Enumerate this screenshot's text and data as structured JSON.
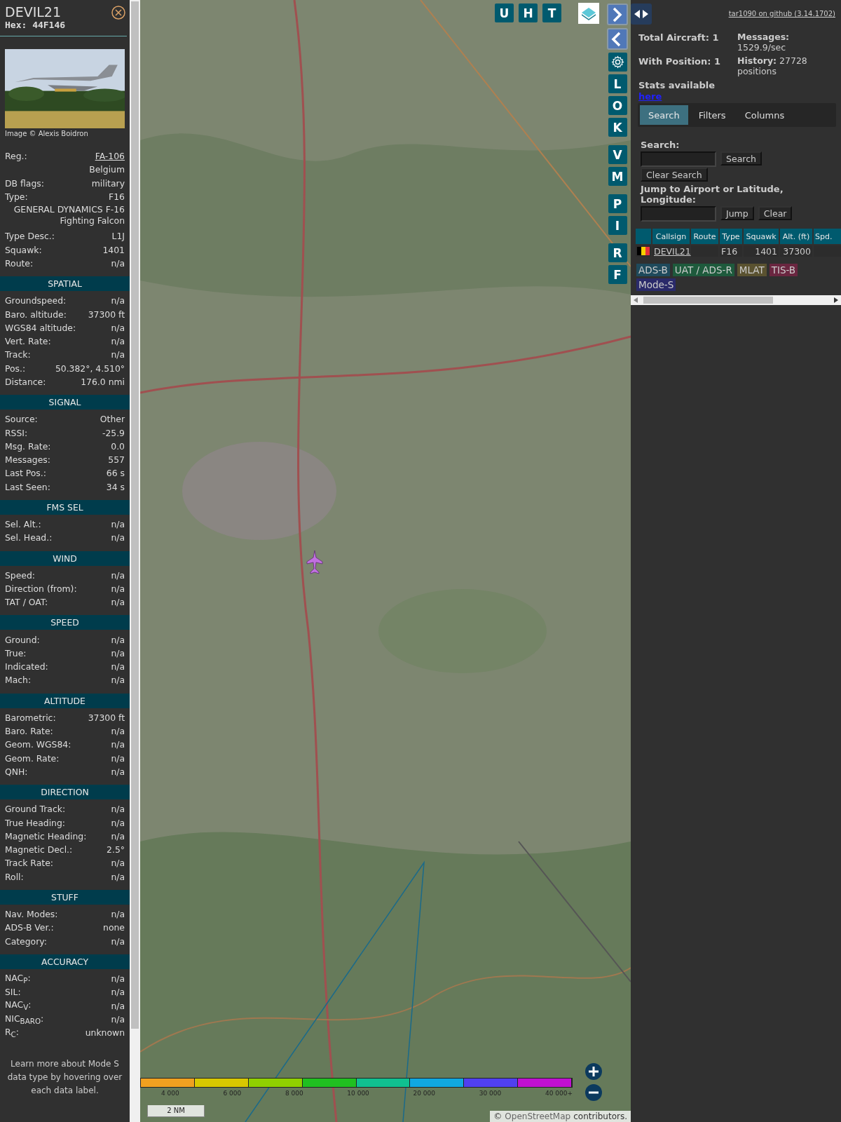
{
  "sidebar": {
    "callsign": "DEVIL21",
    "hex": "Hex: 44F146",
    "photo_credit": "Image © Alexis Boidron",
    "sections": [
      {
        "rows": [
          {
            "kind": "link",
            "label": "Reg.:",
            "value": "FA-106"
          },
          {
            "kind": "value",
            "value": "Belgium"
          },
          {
            "kind": "pair",
            "label": "DB flags:",
            "value": "military"
          },
          {
            "kind": "pair",
            "label": "Type:",
            "value": "F16"
          },
          {
            "kind": "wide",
            "value": "GENERAL DYNAMICS F-16 Fighting Falcon"
          },
          {
            "kind": "pair",
            "label": "Type Desc.:",
            "value": "L1J"
          },
          {
            "kind": "pair",
            "label": "Squawk:",
            "value": "1401"
          },
          {
            "kind": "pair",
            "label": "Route:",
            "value": "n/a"
          }
        ]
      },
      {
        "heading": "SPATIAL",
        "rows": [
          {
            "kind": "pair",
            "label": "Groundspeed:",
            "value": "n/a"
          },
          {
            "kind": "pair",
            "label": "Baro. altitude:",
            "value": "37300 ft"
          },
          {
            "kind": "pair",
            "label": "WGS84 altitude:",
            "value": "n/a"
          },
          {
            "kind": "pair",
            "label": "Vert. Rate:",
            "value": "n/a"
          },
          {
            "kind": "pair",
            "label": "Track:",
            "value": "n/a"
          },
          {
            "kind": "pair",
            "label": "Pos.:",
            "value": "50.382°, 4.510°"
          },
          {
            "kind": "pair",
            "label": "Distance:",
            "value": "176.0 nmi"
          }
        ]
      },
      {
        "heading": "SIGNAL",
        "rows": [
          {
            "kind": "pair",
            "label": "Source:",
            "value": "Other"
          },
          {
            "kind": "pair",
            "label": "RSSI:",
            "value": "-25.9"
          },
          {
            "kind": "pair",
            "label": "Msg. Rate:",
            "value": "0.0"
          },
          {
            "kind": "pair",
            "label": "Messages:",
            "value": "557"
          },
          {
            "kind": "pair",
            "label": "Last Pos.:",
            "value": "66 s"
          },
          {
            "kind": "pair",
            "label": "Last Seen:",
            "value": "34 s"
          }
        ]
      },
      {
        "heading": "FMS SEL",
        "rows": [
          {
            "kind": "pair",
            "label": "Sel. Alt.:",
            "value": "n/a"
          },
          {
            "kind": "pair",
            "label": "Sel. Head.:",
            "value": "n/a"
          }
        ]
      },
      {
        "heading": "WIND",
        "rows": [
          {
            "kind": "pair",
            "label": "Speed:",
            "value": "n/a"
          },
          {
            "kind": "pair",
            "label": "Direction (from):",
            "value": "n/a"
          },
          {
            "kind": "pair",
            "label": "TAT / OAT:",
            "value": "n/a"
          }
        ]
      },
      {
        "heading": "SPEED",
        "rows": [
          {
            "kind": "pair",
            "label": "Ground:",
            "value": "n/a"
          },
          {
            "kind": "pair",
            "label": "True:",
            "value": "n/a"
          },
          {
            "kind": "pair",
            "label": "Indicated:",
            "value": "n/a"
          },
          {
            "kind": "pair",
            "label": "Mach:",
            "value": "n/a"
          }
        ]
      },
      {
        "heading": "ALTITUDE",
        "rows": [
          {
            "kind": "pair",
            "label": "Barometric:",
            "value": "37300 ft"
          },
          {
            "kind": "pair",
            "label": "Baro. Rate:",
            "value": "n/a"
          },
          {
            "kind": "pair",
            "label": "Geom. WGS84:",
            "value": "n/a"
          },
          {
            "kind": "pair",
            "label": "Geom. Rate:",
            "value": "n/a"
          },
          {
            "kind": "pair",
            "label": "QNH:",
            "value": "n/a"
          }
        ]
      },
      {
        "heading": "DIRECTION",
        "rows": [
          {
            "kind": "pair",
            "label": "Ground Track:",
            "value": "n/a"
          },
          {
            "kind": "pair",
            "label": "True Heading:",
            "value": "n/a"
          },
          {
            "kind": "pair",
            "label": "Magnetic Heading:",
            "value": "n/a"
          },
          {
            "kind": "pair",
            "label": "Magnetic Decl.:",
            "value": "2.5°"
          },
          {
            "kind": "pair",
            "label": "Track Rate:",
            "value": "n/a"
          },
          {
            "kind": "pair",
            "label": "Roll:",
            "value": "n/a"
          }
        ]
      },
      {
        "heading": "STUFF",
        "rows": [
          {
            "kind": "pair",
            "label": "Nav. Modes:",
            "value": "n/a"
          },
          {
            "kind": "pair",
            "label": "ADS-B Ver.:",
            "value": "none"
          },
          {
            "kind": "pair",
            "label": "Category:",
            "value": "n/a"
          }
        ]
      },
      {
        "heading": "ACCURACY",
        "rows": [
          {
            "kind": "pair",
            "label": "NAC$_{P}$:",
            "value": "n/a"
          },
          {
            "kind": "pair",
            "label": "SIL:",
            "value": "n/a"
          },
          {
            "kind": "pair",
            "label": "NAC$_{V}$:",
            "value": "n/a"
          },
          {
            "kind": "pair",
            "label": "NIC$_{BARO}$:",
            "value": "n/a"
          },
          {
            "kind": "pair",
            "label": "R$_{C}$:",
            "value": "unknown"
          }
        ]
      }
    ],
    "note": "Learn more about Mode S data type by hovering over each data label."
  },
  "map": {
    "top_buttons": [
      "U",
      "H",
      "T"
    ],
    "side_buttons": [
      "L",
      "O",
      "K",
      "V",
      "M",
      "P",
      "I",
      "R",
      "F"
    ],
    "altitude_legend": [
      "4 000",
      "6 000",
      "8 000",
      "10 000",
      "20 000",
      "30 000",
      "40 000+"
    ],
    "scale": "2 NM",
    "attribution_prefix": "©",
    "attribution_link": "OpenStreetMap",
    "attribution_suffix": "contributors."
  },
  "panel": {
    "github_link": "tar1090 on github (3.14.1702)",
    "stats": {
      "total": "Total Aircraft: 1",
      "with_position": "With Position: 1",
      "stats_text": "Stats available",
      "stats_link": "here",
      "messages_label": "Messages:",
      "messages_value": "1529.9/sec",
      "history": "**History:** 27728 positions"
    },
    "tabs": [
      {
        "label": "Search",
        "selected": true
      },
      {
        "label": "Filters",
        "selected": false
      },
      {
        "label": "Columns",
        "selected": false
      }
    ],
    "search_label": "Search:",
    "search_button": "Search",
    "clear_search_button": "Clear Search",
    "jump_label": "Jump to Airport or Latitude, Longitude:",
    "jump_button": "Jump",
    "clear_button": "Clear",
    "table": {
      "columns": [
        "Callsign",
        "Route",
        "Type",
        "Squawk",
        "Alt. (ft)",
        "Spd."
      ],
      "rows": [
        {
          "callsign": "DEVIL21",
          "type": "F16",
          "squawk": "1401",
          "altitude": "37300"
        }
      ]
    },
    "tags": [
      {
        "label": "ADS-B",
        "color": "#1f4a5c"
      },
      {
        "label": "UAT / ADS-R",
        "color": "#1e5a3c"
      },
      {
        "label": "MLAT",
        "color": "#5a5230"
      },
      {
        "label": "TIS-B",
        "color": "#6a2640"
      },
      {
        "label": "Mode-S",
        "color": "#2a2a6a"
      }
    ]
  }
}
